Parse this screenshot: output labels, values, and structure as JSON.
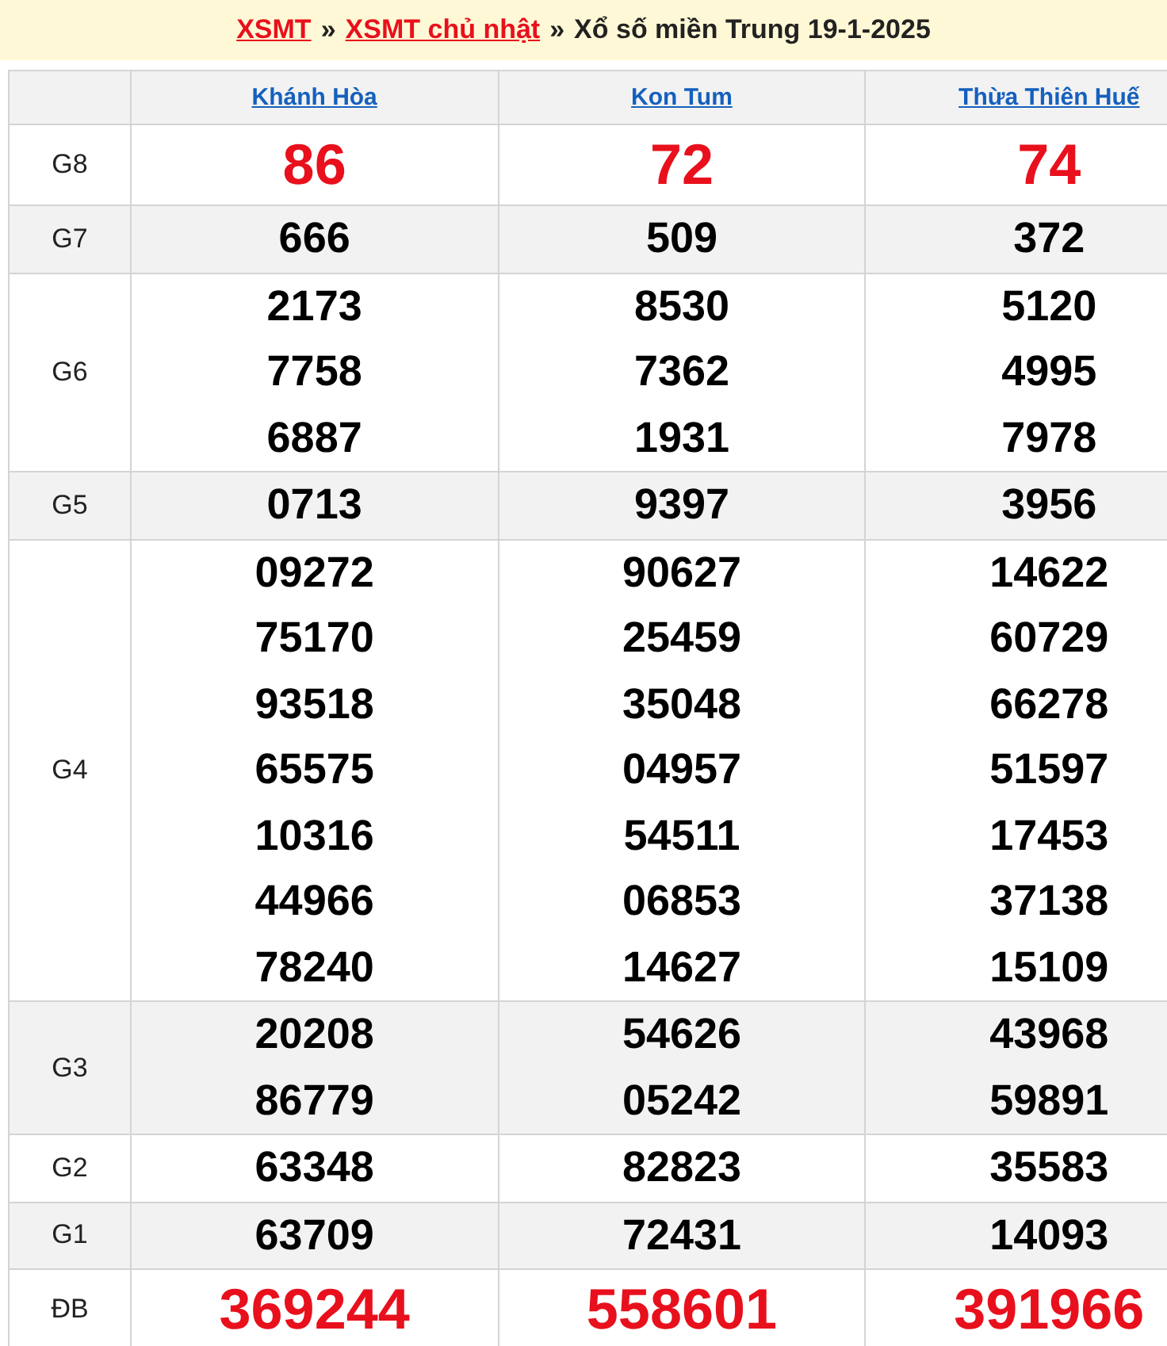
{
  "breadcrumb": {
    "separator": "»",
    "items": [
      {
        "text": "XSMT",
        "kind": "link"
      },
      {
        "text": "XSMT chủ nhật",
        "kind": "link"
      },
      {
        "text": "Xổ số miền Trung 19-1-2025",
        "kind": "text"
      }
    ]
  },
  "provinces": [
    "Khánh Hòa",
    "Kon Tum",
    "Thừa Thiên Huế"
  ],
  "prizes": [
    {
      "name": "G8",
      "kind": "highlight",
      "results": [
        [
          "86"
        ],
        [
          "72"
        ],
        [
          "74"
        ]
      ]
    },
    {
      "name": "G7",
      "kind": "normal",
      "results": [
        [
          "666"
        ],
        [
          "509"
        ],
        [
          "372"
        ]
      ]
    },
    {
      "name": "G6",
      "kind": "normal",
      "results": [
        [
          "2173",
          "7758",
          "6887"
        ],
        [
          "8530",
          "7362",
          "1931"
        ],
        [
          "5120",
          "4995",
          "7978"
        ]
      ]
    },
    {
      "name": "G5",
      "kind": "normal",
      "results": [
        [
          "0713"
        ],
        [
          "9397"
        ],
        [
          "3956"
        ]
      ]
    },
    {
      "name": "G4",
      "kind": "normal",
      "results": [
        [
          "09272",
          "75170",
          "93518",
          "65575",
          "10316",
          "44966",
          "78240"
        ],
        [
          "90627",
          "25459",
          "35048",
          "04957",
          "54511",
          "06853",
          "14627"
        ],
        [
          "14622",
          "60729",
          "66278",
          "51597",
          "17453",
          "37138",
          "15109"
        ]
      ]
    },
    {
      "name": "G3",
      "kind": "normal",
      "results": [
        [
          "20208",
          "86779"
        ],
        [
          "54626",
          "05242"
        ],
        [
          "43968",
          "59891"
        ]
      ]
    },
    {
      "name": "G2",
      "kind": "normal",
      "results": [
        [
          "63348"
        ],
        [
          "82823"
        ],
        [
          "35583"
        ]
      ]
    },
    {
      "name": "G1",
      "kind": "normal",
      "results": [
        [
          "63709"
        ],
        [
          "72431"
        ],
        [
          "14093"
        ]
      ]
    },
    {
      "name": "ĐB",
      "kind": "highlight",
      "results": [
        [
          "369244"
        ],
        [
          "558601"
        ],
        [
          "391966"
        ]
      ]
    }
  ]
}
